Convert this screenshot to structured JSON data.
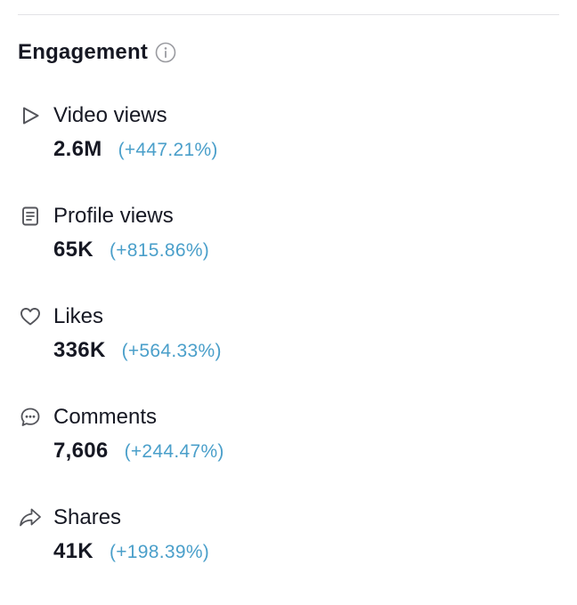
{
  "section": {
    "title": "Engagement",
    "info_icon": "info-circle-icon"
  },
  "accent_color": "#4a9fca",
  "metrics": [
    {
      "icon": "play-icon",
      "label": "Video views",
      "value": "2.6M",
      "change": "(+447.21%)"
    },
    {
      "icon": "document-icon",
      "label": "Profile views",
      "value": "65K",
      "change": "(+815.86%)"
    },
    {
      "icon": "heart-icon",
      "label": "Likes",
      "value": "336K",
      "change": "(+564.33%)"
    },
    {
      "icon": "comment-icon",
      "label": "Comments",
      "value": "7,606",
      "change": "(+244.47%)"
    },
    {
      "icon": "share-icon",
      "label": "Shares",
      "value": "41K",
      "change": "(+198.39%)"
    }
  ]
}
